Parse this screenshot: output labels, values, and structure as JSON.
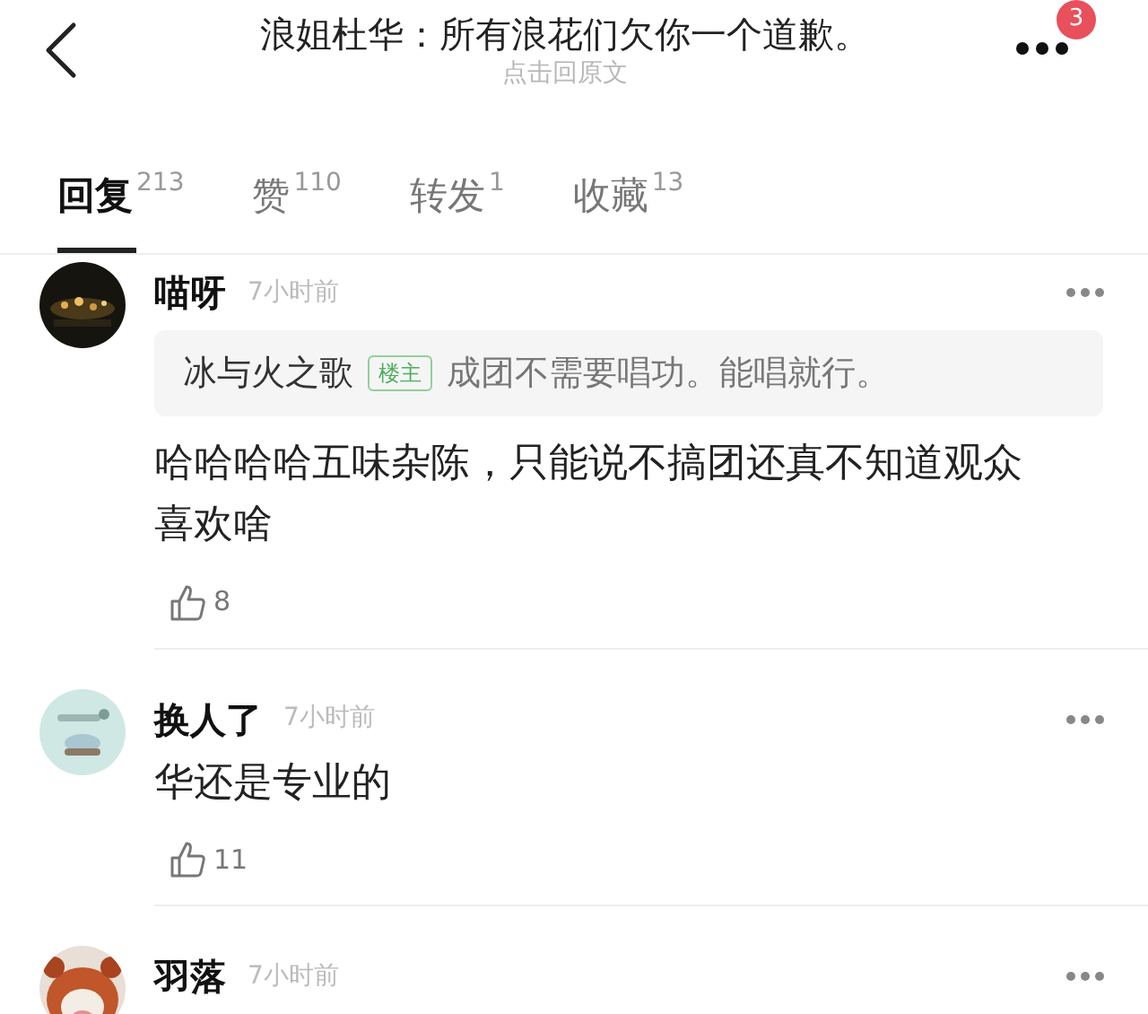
{
  "header": {
    "title": "浪姐杜华：所有浪花们欠你一个道歉。",
    "subtitle": "点击回原文",
    "badge": "3"
  },
  "tabs": [
    {
      "label": "回复",
      "count": "213",
      "selected": true
    },
    {
      "label": "赞",
      "count": "110",
      "selected": false
    },
    {
      "label": "转发",
      "count": "1",
      "selected": false
    },
    {
      "label": "收藏",
      "count": "13",
      "selected": false
    }
  ],
  "comments": [
    {
      "name": "喵呀",
      "time": "7小时前",
      "quote": {
        "author": "冰与火之歌",
        "tag": "楼主",
        "text": "成团不需要唱功。能唱就行。"
      },
      "body": "哈哈哈哈五味杂陈，只能说不搞团还真不知道观众喜欢啥",
      "likes": "8"
    },
    {
      "name": "换人了",
      "time": "7小时前",
      "body": "华还是专业的",
      "likes": "11"
    },
    {
      "name": "羽落",
      "time": "7小时前"
    }
  ]
}
